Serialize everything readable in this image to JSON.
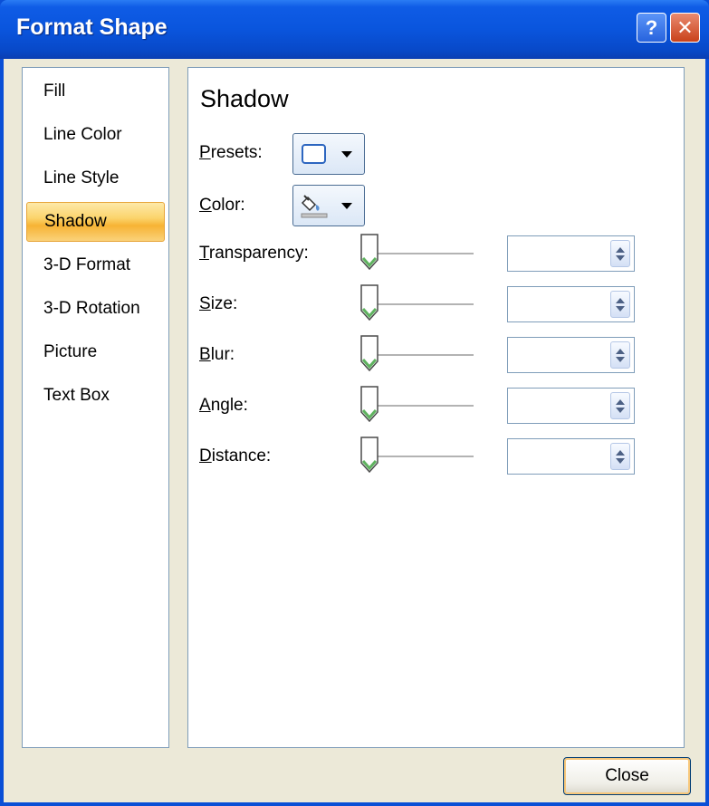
{
  "window": {
    "title": "Format Shape",
    "help_glyph": "?",
    "close_glyph": "✕"
  },
  "nav": {
    "items": [
      {
        "label": "Fill",
        "selected": false
      },
      {
        "label": "Line Color",
        "selected": false
      },
      {
        "label": "Line Style",
        "selected": false
      },
      {
        "label": "Shadow",
        "selected": true
      },
      {
        "label": "3-D Format",
        "selected": false
      },
      {
        "label": "3-D Rotation",
        "selected": false
      },
      {
        "label": "Picture",
        "selected": false
      },
      {
        "label": "Text Box",
        "selected": false
      }
    ]
  },
  "panel": {
    "title": "Shadow",
    "presets": {
      "mnemonic": "P",
      "rest": "resets:"
    },
    "color": {
      "mnemonic": "C",
      "rest": "olor:"
    },
    "fields": [
      {
        "mnemonic": "T",
        "rest": "ransparency:",
        "value": ""
      },
      {
        "mnemonic": "S",
        "rest": "ize:",
        "value": ""
      },
      {
        "mnemonic": "B",
        "rest": "lur:",
        "value": ""
      },
      {
        "mnemonic": "A",
        "rest": "ngle:",
        "value": ""
      },
      {
        "mnemonic": "D",
        "rest": "istance:",
        "value": ""
      }
    ]
  },
  "footer": {
    "close_label": "Close"
  },
  "colors": {
    "titlebar": "#0a55dd",
    "selected_nav": "#fbd46c",
    "slider_thumb": "#5fb25f"
  }
}
